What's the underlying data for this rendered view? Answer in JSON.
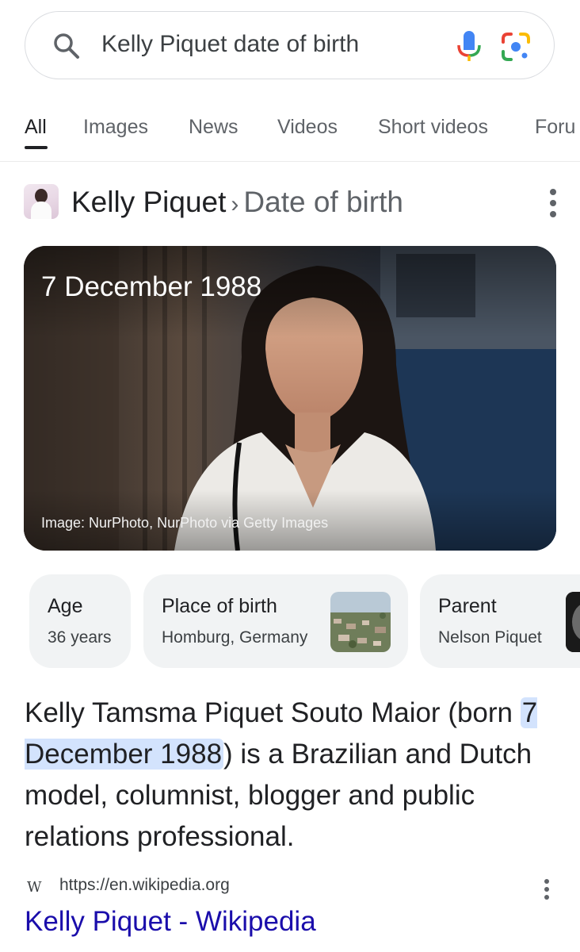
{
  "search": {
    "query": "Kelly Piquet date of birth",
    "icons": [
      "search-icon",
      "microphone-icon",
      "google-lens-icon"
    ]
  },
  "tabs": [
    "All",
    "Images",
    "News",
    "Videos",
    "Short videos",
    "Foru"
  ],
  "active_tab": "All",
  "entity": {
    "name": "Kelly Piquet",
    "separator": "›",
    "attribute": "Date of birth"
  },
  "hero": {
    "date": "7 December 1988",
    "credit": "Image: NurPhoto, NurPhoto via Getty Images"
  },
  "chips": [
    {
      "label": "Age",
      "value": "36 years"
    },
    {
      "label": "Place of birth",
      "value": "Homburg, Germany"
    },
    {
      "label": "Parent",
      "value": "Nelson Piquet"
    }
  ],
  "description": {
    "before": "Kelly Tamsma Piquet Souto Maior (born ",
    "highlight": "7 December 1988",
    "after": ") is a Brazilian and Dutch model, columnist, blogger and public relations professional."
  },
  "source": {
    "favicon": "W",
    "url": "https://en.wikipedia.org",
    "title": "Kelly Piquet - Wikipedia"
  },
  "colors": {
    "link": "#1a0dab",
    "highlight": "#d3e3fd",
    "chip_bg": "#f1f3f4"
  }
}
